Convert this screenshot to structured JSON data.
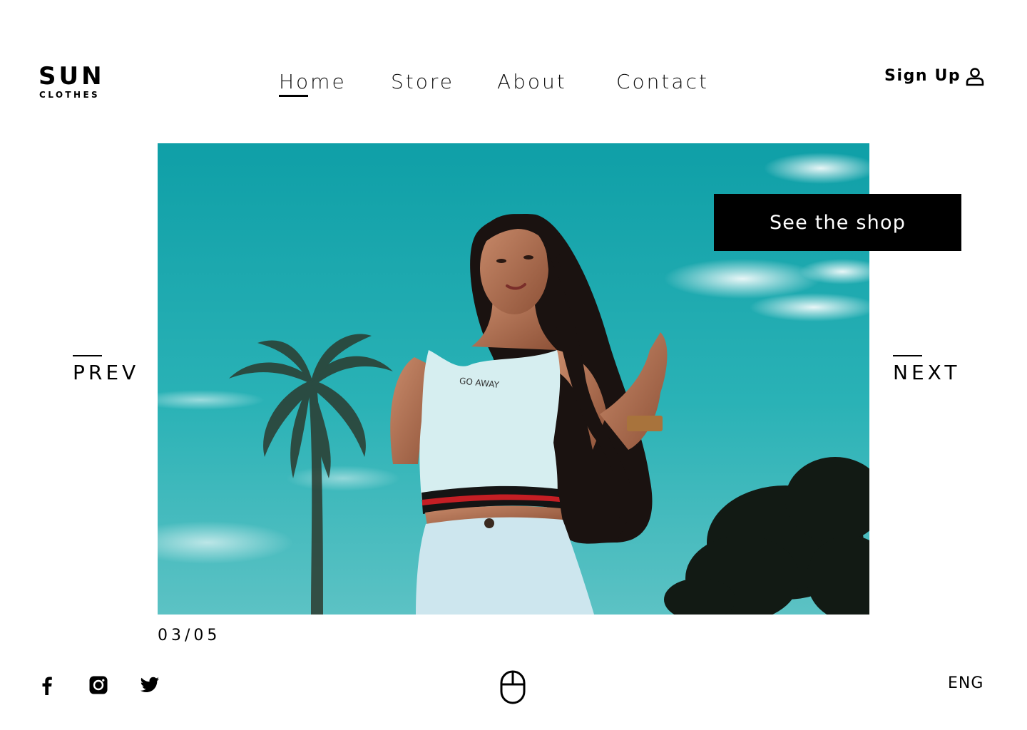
{
  "brand": {
    "name": "SUN",
    "tagline": "CLOTHES"
  },
  "nav": {
    "items": [
      {
        "label": "Home",
        "active": true
      },
      {
        "label": "Store",
        "active": false
      },
      {
        "label": "About",
        "active": false
      },
      {
        "label": "Contact",
        "active": false
      }
    ]
  },
  "account": {
    "signup_label": "Sign Up",
    "icon": "user-icon"
  },
  "hero": {
    "shirt_text": "GO AWAY",
    "cta_label": "See the shop",
    "sky_color": "#1fa6ac"
  },
  "slider": {
    "prev_label": "PREV",
    "next_label": "NEXT",
    "counter": "03/05",
    "current": 3,
    "total": 5
  },
  "footer": {
    "social": [
      {
        "name": "facebook-icon"
      },
      {
        "name": "instagram-icon"
      },
      {
        "name": "twitter-icon"
      }
    ],
    "scroll_icon": "mouse-icon",
    "language": "ENG"
  },
  "colors": {
    "text": "#000000",
    "button_bg": "#000000",
    "button_text": "#ffffff",
    "background": "#ffffff"
  }
}
